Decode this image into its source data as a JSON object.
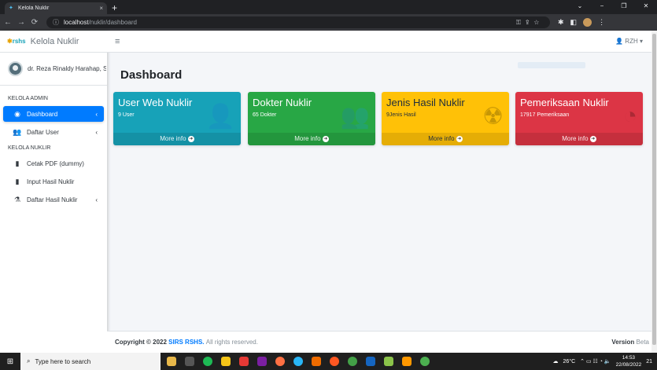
{
  "browser": {
    "tab_title": "Kelola Nuklir",
    "tab_close": "×",
    "new_tab": "+",
    "url_host": "localhost",
    "url_path": "/nuklir/dashboard",
    "win_min": "−",
    "win_max": "❐",
    "win_close": "✕",
    "win_down": "⌄"
  },
  "sidebar": {
    "brand_logo": "rshs",
    "brand_text": "Kelola Nuklir",
    "user_name": "dr. Reza Rinaldy Harahap, S",
    "sections": [
      {
        "header": "KELOLA ADMIN",
        "items": [
          {
            "label": "Dashboard",
            "icon": "tachometer-icon",
            "glyph": "◉",
            "chevron": "‹",
            "active": true
          },
          {
            "label": "Daftar User",
            "icon": "users-icon",
            "glyph": "👥",
            "chevron": "‹"
          }
        ]
      },
      {
        "header": "KELOLA NUKLIR",
        "items": [
          {
            "label": "Cetak PDF (dummy)",
            "icon": "file-icon",
            "glyph": "▮"
          },
          {
            "label": "Input Hasil Nuklir",
            "icon": "file-icon",
            "glyph": "▮"
          },
          {
            "label": "Daftar Hasil Nuklir",
            "icon": "flask-icon",
            "glyph": "⚗",
            "chevron": "‹"
          }
        ]
      }
    ]
  },
  "topnav": {
    "menu_glyph": "≡",
    "user_label": "RZH",
    "user_glyph": "👤",
    "caret": "▾"
  },
  "content": {
    "title": "Dashboard",
    "boxes": [
      {
        "title": "User Web Nuklir",
        "subtitle": "9 User",
        "glyph": "👤",
        "more": "More info",
        "arrow": "➜",
        "color": "info"
      },
      {
        "title": "Dokter Nuklir",
        "subtitle": "65 Dokter",
        "glyph": "👥",
        "more": "More info",
        "arrow": "➜",
        "color": "success"
      },
      {
        "title": "Jenis Hasil Nuklir",
        "subtitle": "9Jenis Hasil",
        "glyph": "☢",
        "more": "More info",
        "arrow": "➜",
        "color": "warning"
      },
      {
        "title": "Pemeriksaan Nuklir",
        "subtitle": "17917 Pemeriksaan",
        "glyph": "◔",
        "more": "More info",
        "arrow": "➜",
        "color": "danger"
      }
    ]
  },
  "footer": {
    "copyright_prefix": "Copyright © 2022",
    "copyright_link": "SIRS RSHS.",
    "copyright_suffix": "All rights reserved.",
    "version_label": "Version",
    "version_value": "Beta"
  },
  "taskbar": {
    "search_placeholder": "Type here to search",
    "temperature": "26°C",
    "time": "14:53",
    "date": "22/08/2022",
    "notif_count": "21"
  },
  "colors": {
    "info": "#17a2b8",
    "success": "#28a745",
    "warning": "#ffc107",
    "danger": "#dc3545",
    "primary": "#007bff"
  }
}
